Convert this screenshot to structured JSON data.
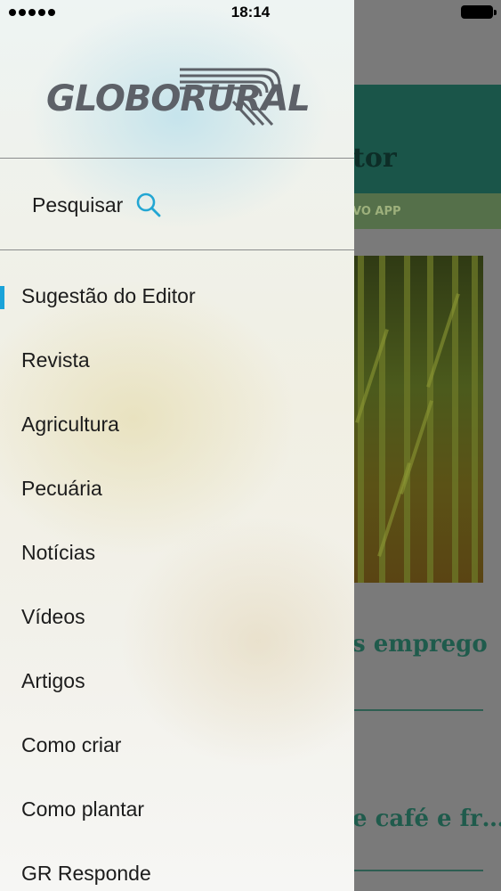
{
  "status_bar": {
    "time": "18:14"
  },
  "drawer": {
    "logo_text": "GLOBORURAL",
    "search_label": "Pesquisar",
    "menu_items": [
      {
        "label": "Sugestão do Editor",
        "selected": true
      },
      {
        "label": "Revista"
      },
      {
        "label": "Agricultura"
      },
      {
        "label": "Pecuária"
      },
      {
        "label": "Notícias"
      },
      {
        "label": "Vídeos"
      },
      {
        "label": "Artigos"
      },
      {
        "label": "Como criar"
      },
      {
        "label": "Como plantar"
      },
      {
        "label": "GR Responde"
      }
    ]
  },
  "background": {
    "header_title_fragment": "tor",
    "banner_fragment": "VO APP",
    "headline_1_fragment": "s emprego",
    "headline_2_fragment": "e café e fr…"
  },
  "colors": {
    "accent": "#1aa3d9",
    "header": "#1a5549",
    "headline": "#1f5b4c"
  }
}
